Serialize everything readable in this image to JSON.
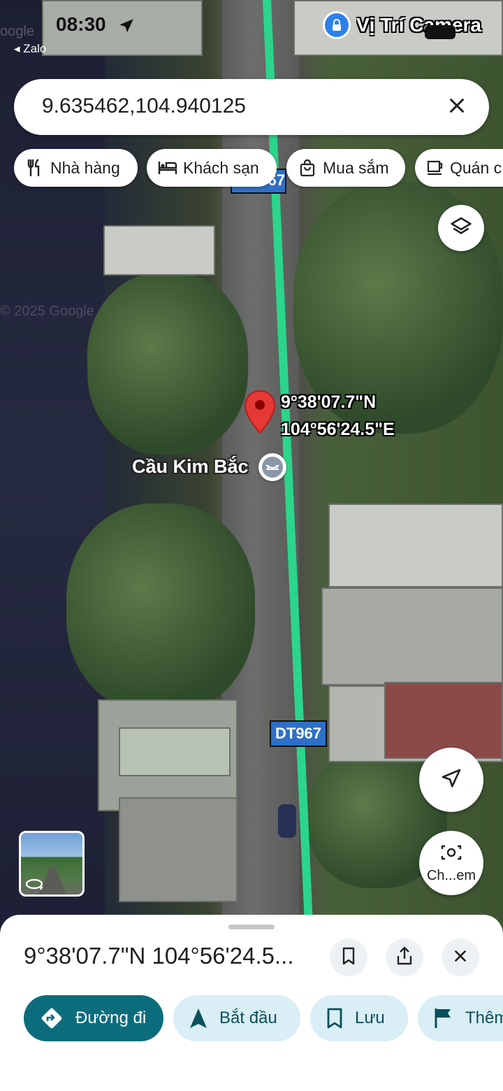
{
  "status_bar": {
    "time": "08:30",
    "back_app": "◂ Zalo",
    "overlay_text": "Vị Trí Camera"
  },
  "search": {
    "query": "9.635462,104.940125"
  },
  "chips": [
    {
      "label": "Nhà hàng",
      "icon": "fork-knife-icon"
    },
    {
      "label": "Khách sạn",
      "icon": "bed-icon"
    },
    {
      "label": "Mua sắm",
      "icon": "shopping-bag-icon"
    },
    {
      "label": "Quán c",
      "icon": "coffee-cup-icon"
    }
  ],
  "map": {
    "road_sign_top": "67",
    "road_sign_bottom": "DT967",
    "marker_lat": "9°38'07.7\"N",
    "marker_lng": "104°56'24.5\"E",
    "place_name": "Cầu Kim Bắc",
    "watermark": "© 2025 Google",
    "watermark_top": "oogle",
    "camera_button_label": "Ch...em",
    "colors": {
      "route_line": "#2bd58c",
      "marker": "#e53935"
    }
  },
  "sheet": {
    "title": "9°38'07.7\"N 104°56'24.5...",
    "actions": [
      {
        "label": "Đường đi",
        "icon": "directions-icon"
      },
      {
        "label": "Bắt đầu",
        "icon": "navigation-arrow-icon"
      },
      {
        "label": "Lưu",
        "icon": "bookmark-icon"
      },
      {
        "label": "Thêm",
        "icon": "flag-icon"
      }
    ]
  }
}
